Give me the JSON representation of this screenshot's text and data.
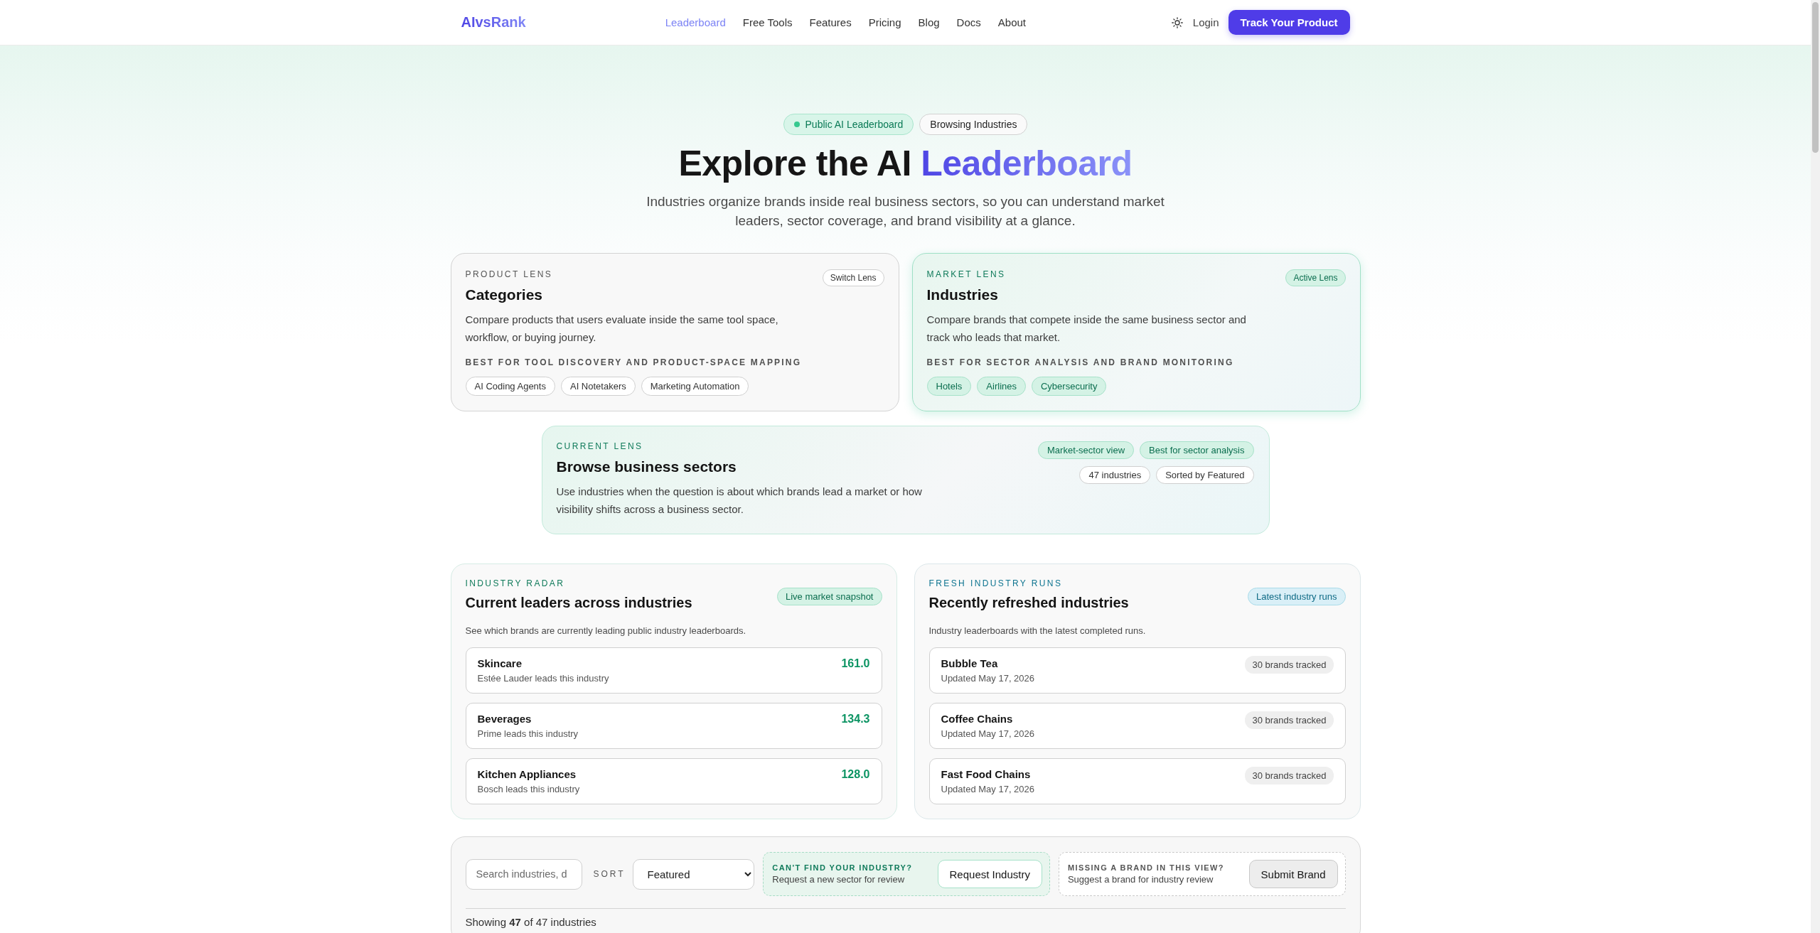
{
  "nav": {
    "logo": "AIvsRank",
    "links": [
      {
        "label": "Leaderboard",
        "selected": true
      },
      {
        "label": "Free Tools",
        "selected": false
      },
      {
        "label": "Features",
        "selected": false
      },
      {
        "label": "Pricing",
        "selected": false
      },
      {
        "label": "Blog",
        "selected": false
      },
      {
        "label": "Docs",
        "selected": false
      },
      {
        "label": "About",
        "selected": false
      }
    ],
    "login": "Login",
    "cta": "Track Your Product"
  },
  "hero": {
    "badges": [
      {
        "label": "Public AI Leaderboard",
        "kind": "status"
      },
      {
        "label": "Browsing Industries",
        "kind": "plain"
      }
    ],
    "title": "Explore the AI",
    "title_highlight": "Leaderboard",
    "subtitle": "Industries organize brands inside real business sectors, so you can understand market leaders, sector coverage, and brand visibility at a glance."
  },
  "lenses": [
    {
      "eyebrow": "PRODUCT LENS",
      "title": "Categories",
      "badge": "Switch Lens",
      "selected": false,
      "description": "Compare products that users evaluate inside the same tool space, workflow, or buying journey.",
      "best_for": "BEST FOR TOOL DISCOVERY AND PRODUCT-SPACE MAPPING",
      "examples": [
        "AI Coding Agents",
        "AI Notetakers",
        "Marketing Automation"
      ]
    },
    {
      "eyebrow": "MARKET LENS",
      "title": "Industries",
      "badge": "Active Lens",
      "selected": true,
      "description": "Compare brands that compete inside the same business sector and track who leads that market.",
      "best_for": "BEST FOR SECTOR ANALYSIS AND BRAND MONITORING",
      "examples": [
        "Hotels",
        "Airlines",
        "Cybersecurity"
      ]
    }
  ],
  "current_lens": {
    "eyebrow": "CURRENT LENS",
    "title": "Browse business sectors",
    "description": "Use industries when the question is about which brands lead a market or how visibility shifts across a business sector.",
    "tag_rows": [
      [
        {
          "label": "Market-sector view",
          "kind": "accent"
        },
        {
          "label": "Best for sector analysis",
          "kind": "accent"
        }
      ],
      [
        {
          "label": "47 industries",
          "kind": "outline"
        },
        {
          "label": "Sorted by Featured",
          "kind": "outline"
        }
      ]
    ]
  },
  "panels": [
    {
      "kind": "leaders",
      "eyebrow": "INDUSTRY RADAR",
      "title": "Current leaders across industries",
      "badge": "Live market snapshot",
      "description": "See which brands are currently leading public industry leaderboards.",
      "rows": [
        {
          "name": "Skincare",
          "detail": "Estée Lauder leads this industry",
          "value": "161.0"
        },
        {
          "name": "Beverages",
          "detail": "Prime leads this industry",
          "value": "134.3"
        },
        {
          "name": "Kitchen Appliances",
          "detail": "Bosch leads this industry",
          "value": "128.0"
        }
      ]
    },
    {
      "kind": "recent",
      "eyebrow": "FRESH INDUSTRY RUNS",
      "title": "Recently refreshed industries",
      "badge": "Latest industry runs",
      "description": "Industry leaderboards with the latest completed runs.",
      "rows": [
        {
          "name": "Bubble Tea",
          "detail": "Updated May 17, 2026",
          "value": "30 brands tracked"
        },
        {
          "name": "Coffee Chains",
          "detail": "Updated May 17, 2026",
          "value": "30 brands tracked"
        },
        {
          "name": "Fast Food Chains",
          "detail": "Updated May 17, 2026",
          "value": "30 brands tracked"
        }
      ]
    }
  ],
  "filters": {
    "search": {
      "placeholder": "Search industries, d"
    },
    "sort_label": "SORT",
    "sort": {
      "value": "Featured"
    },
    "prompts": [
      {
        "kind": "accent",
        "eyebrow": "CAN'T FIND YOUR INDUSTRY?",
        "text": "Request a new sector for review",
        "button": "Request Industry"
      },
      {
        "kind": "neutral",
        "eyebrow": "MISSING A BRAND IN THIS VIEW?",
        "text": "Suggest a brand for industry review",
        "button": "Submit Brand"
      }
    ],
    "summary": "Showing **47** of 47 industries"
  }
}
